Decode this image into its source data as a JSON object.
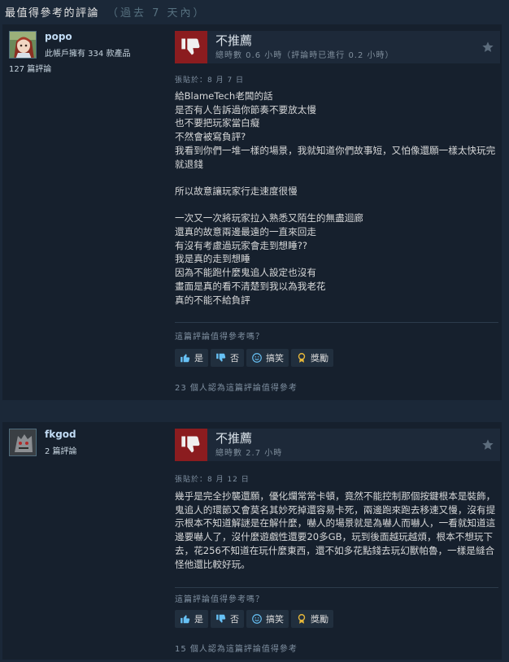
{
  "header": {
    "title": "最值得參考的評論",
    "range": "（過去 7 天內）"
  },
  "vote_buttons": {
    "yes": "是",
    "no": "否",
    "funny": "搞笑",
    "award": "獎勵"
  },
  "reviews": [
    {
      "author": "popo",
      "products": "此帳戶擁有 334 款產品",
      "review_count": "127 篇評論",
      "recommendation": "不推薦",
      "hours": "總時數 0.6 小時（評論時已進行 0.2 小時）",
      "posted": "張貼於：8 月 7 日",
      "content": "給BlameTech老闆的話\n是否有人告訴過你節奏不要放太慢\n也不要把玩家當白癡\n不然會被寫負評?\n我看到你們一堆一樣的場景，我就知道你們故事短，又怕像還願一樣太快玩完就退錢\n\n所以故意讓玩家行走速度很慢\n\n一次又一次將玩家拉入熟悉又陌生的無盡迴廊\n還真的故意兩邊最遠的一直來回走\n有沒有考慮過玩家會走到想睡??\n我是真的走到想睡\n因為不能跑什麼鬼追人設定也沒有\n畫面是真的看不清楚到我以為我老花\n真的不能不給負評",
      "helpful_question": "這篇評論值得參考嗎？",
      "found_helpful": "23 個人認為這篇評論值得參考"
    },
    {
      "author": "fkgod",
      "products": "",
      "review_count": "2 篇評論",
      "recommendation": "不推薦",
      "hours": "總時數 2.7 小時",
      "posted": "張貼於：8 月 12 日",
      "content": "幾乎是完全抄襲還願，優化爛常常卡頓，竟然不能控制那個按鍵根本是裝飾，鬼追人的環節又會莫名其妙死掉還容易卡死，兩邊跑來跑去移速又慢，沒有提示根本不知道解謎是在解什麼，嚇人的場景就是為嚇人而嚇人，一看就知道這邊要嚇人了，沒什麼遊戲性還要20多GB，玩到後面越玩越煩，根本不想玩下去，花256不知道在玩什麼東西，還不如多花點錢去玩幻獸帕魯，一樣是縫合怪他還比較好玩。",
      "helpful_question": "這篇評論值得參考嗎？",
      "found_helpful": "15 個人認為這篇評論值得參考"
    }
  ],
  "colors": {
    "background": "#1b2838",
    "card": "#16202d",
    "thumbs_down": "#8b1c1f",
    "persona": "#c1dbf4",
    "award_icon": "#e6b73a"
  },
  "icons": [
    "thumbs-down-icon",
    "star-icon",
    "thumbs-up-icon",
    "smiley-icon",
    "award-icon"
  ]
}
